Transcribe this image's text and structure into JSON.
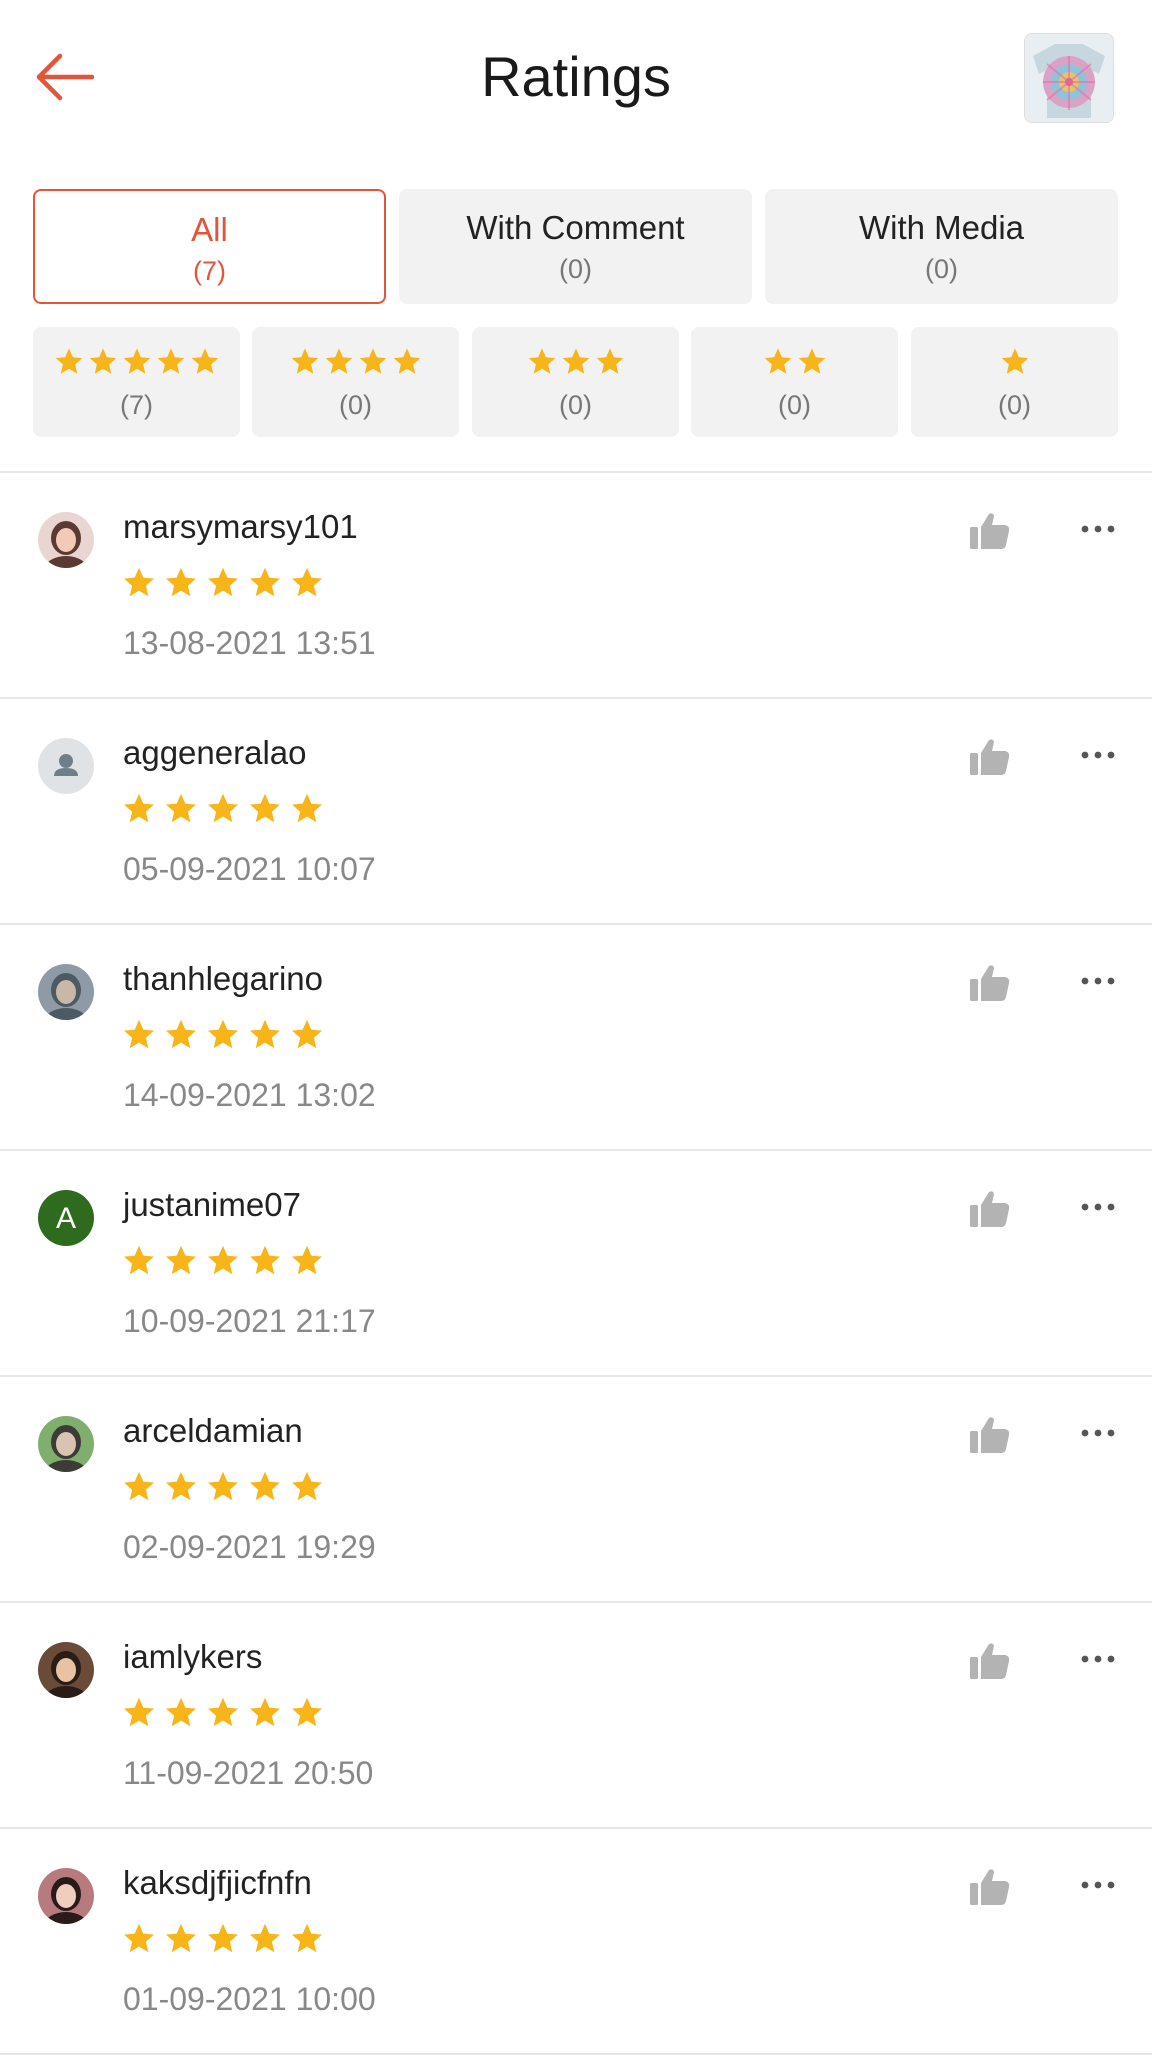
{
  "header": {
    "title": "Ratings",
    "back_icon": "arrow-left-icon",
    "product_thumbnail_icon": "product-image"
  },
  "colors": {
    "accent": "#e2553a",
    "star": "#f8b51a",
    "muted_text": "#888888",
    "tab_bg": "#f2f2f2"
  },
  "tabs": [
    {
      "label": "All",
      "count": "(7)",
      "active": true
    },
    {
      "label": "With Comment",
      "count": "(0)",
      "active": false
    },
    {
      "label": "With Media",
      "count": "(0)",
      "active": false
    }
  ],
  "star_filters": [
    {
      "stars": 5,
      "count": "(7)"
    },
    {
      "stars": 4,
      "count": "(0)"
    },
    {
      "stars": 3,
      "count": "(0)"
    },
    {
      "stars": 2,
      "count": "(0)"
    },
    {
      "stars": 1,
      "count": "(0)"
    }
  ],
  "reviews": [
    {
      "username": "marsymarsy101",
      "rating": 5,
      "date": "13-08-2021 13:51",
      "avatar": "photo"
    },
    {
      "username": "aggeneralao",
      "rating": 5,
      "date": "05-09-2021 10:07",
      "avatar": "default-person"
    },
    {
      "username": "thanhlegarino",
      "rating": 5,
      "date": "14-09-2021 13:02",
      "avatar": "photo"
    },
    {
      "username": "justanime07",
      "rating": 5,
      "date": "10-09-2021 21:17",
      "avatar": "letter",
      "avatar_letter": "A"
    },
    {
      "username": "arceldamian",
      "rating": 5,
      "date": "02-09-2021 19:29",
      "avatar": "photo"
    },
    {
      "username": "iamlykers",
      "rating": 5,
      "date": "11-09-2021 20:50",
      "avatar": "photo"
    },
    {
      "username": "kaksdjfjicfnfn",
      "rating": 5,
      "date": "01-09-2021 10:00",
      "avatar": "photo"
    }
  ],
  "review_actions": {
    "like_icon": "thumbs-up-icon",
    "more_icon": "more-horizontal-icon"
  }
}
